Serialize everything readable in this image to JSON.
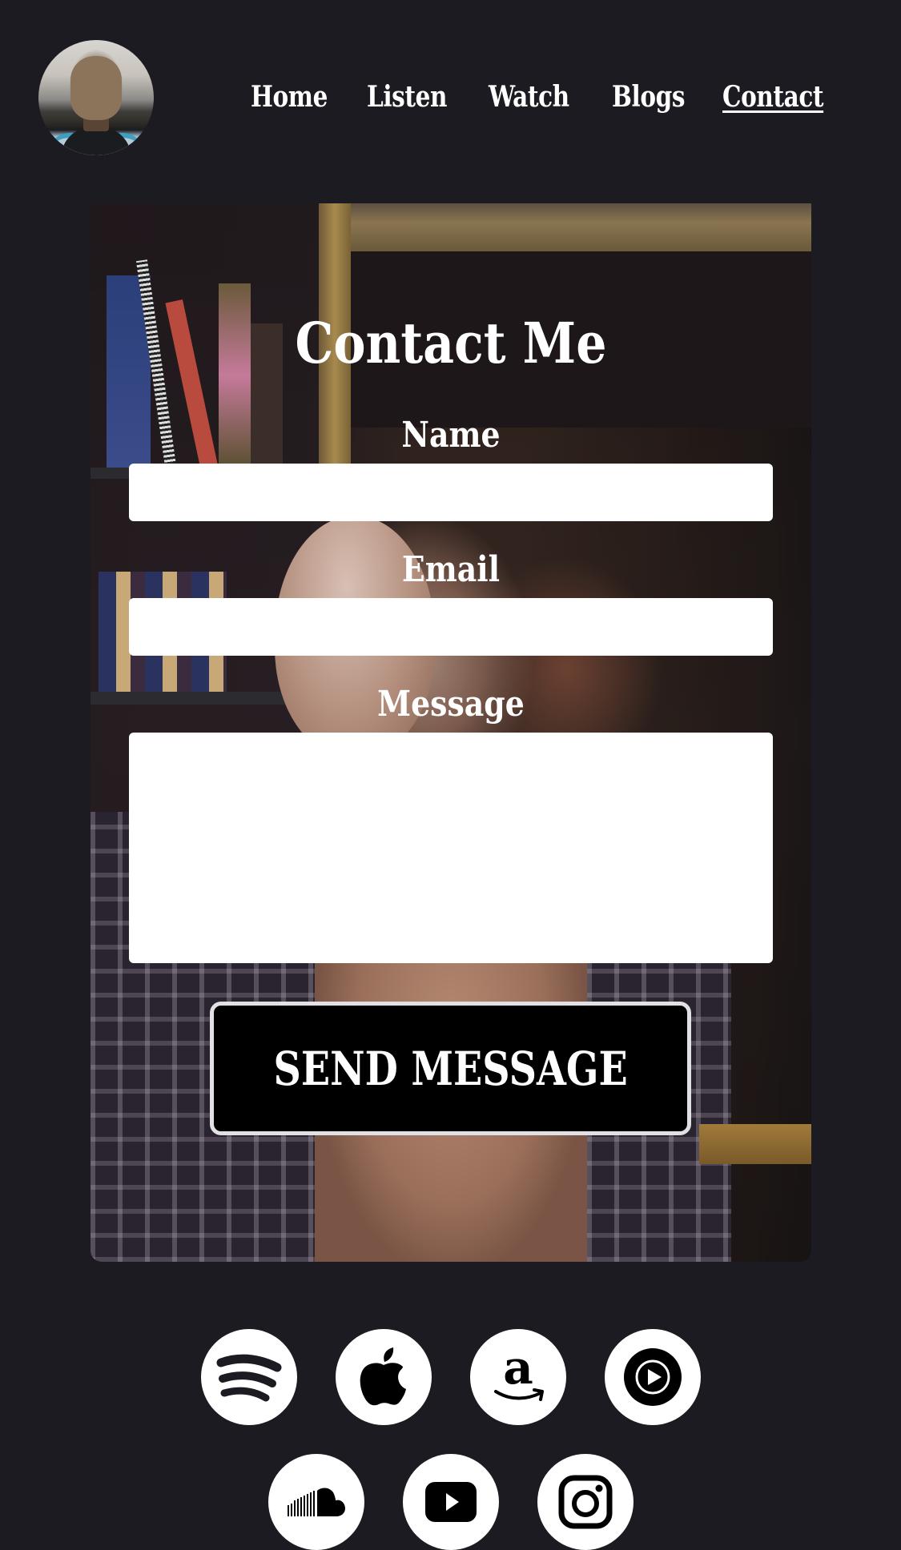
{
  "header": {
    "avatar_alt": "profile photo",
    "nav": [
      {
        "label": "Home",
        "active": false
      },
      {
        "label": "Listen",
        "active": false
      },
      {
        "label": "Watch",
        "active": false
      },
      {
        "label": "Blogs",
        "active": false
      },
      {
        "label": "Contact",
        "active": true
      }
    ]
  },
  "form": {
    "title": "Contact Me",
    "fields": {
      "name": {
        "label": "Name",
        "value": "",
        "placeholder": ""
      },
      "email": {
        "label": "Email",
        "value": "",
        "placeholder": ""
      },
      "message": {
        "label": "Message",
        "value": "",
        "placeholder": ""
      }
    },
    "submit_label": "SEND MESSAGE"
  },
  "social": {
    "row1": [
      {
        "name": "spotify",
        "icon": "spotify-icon"
      },
      {
        "name": "apple-music",
        "icon": "apple-icon"
      },
      {
        "name": "amazon-music",
        "icon": "amazon-icon"
      },
      {
        "name": "youtube-music",
        "icon": "youtube-music-icon"
      }
    ],
    "row2": [
      {
        "name": "soundcloud",
        "icon": "soundcloud-icon"
      },
      {
        "name": "youtube",
        "icon": "youtube-icon"
      },
      {
        "name": "instagram",
        "icon": "instagram-icon"
      }
    ]
  },
  "colors": {
    "page_bg": "#1c1b21",
    "text": "#ffffff",
    "button_bg": "#000000",
    "button_border": "#e1e1e5",
    "icon_circle": "#ffffff"
  }
}
